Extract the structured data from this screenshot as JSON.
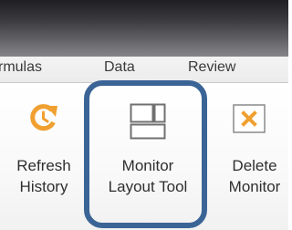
{
  "tabs": {
    "formulas": "rmulas",
    "data": "Data",
    "review": "Review"
  },
  "buttons": {
    "refresh_history": {
      "line1": "Refresh",
      "line2": "History",
      "icon": "refresh-history-icon",
      "color": "#f0a030"
    },
    "monitor_layout_tool": {
      "line1": "Monitor",
      "line2": "Layout Tool",
      "icon": "monitor-layout-icon",
      "color": "#707070"
    },
    "delete_monitor": {
      "line1": "Delete",
      "line2": "Monitor",
      "icon": "delete-x-icon",
      "color": "#f0a030"
    }
  },
  "highlight_color": "#3b6496"
}
